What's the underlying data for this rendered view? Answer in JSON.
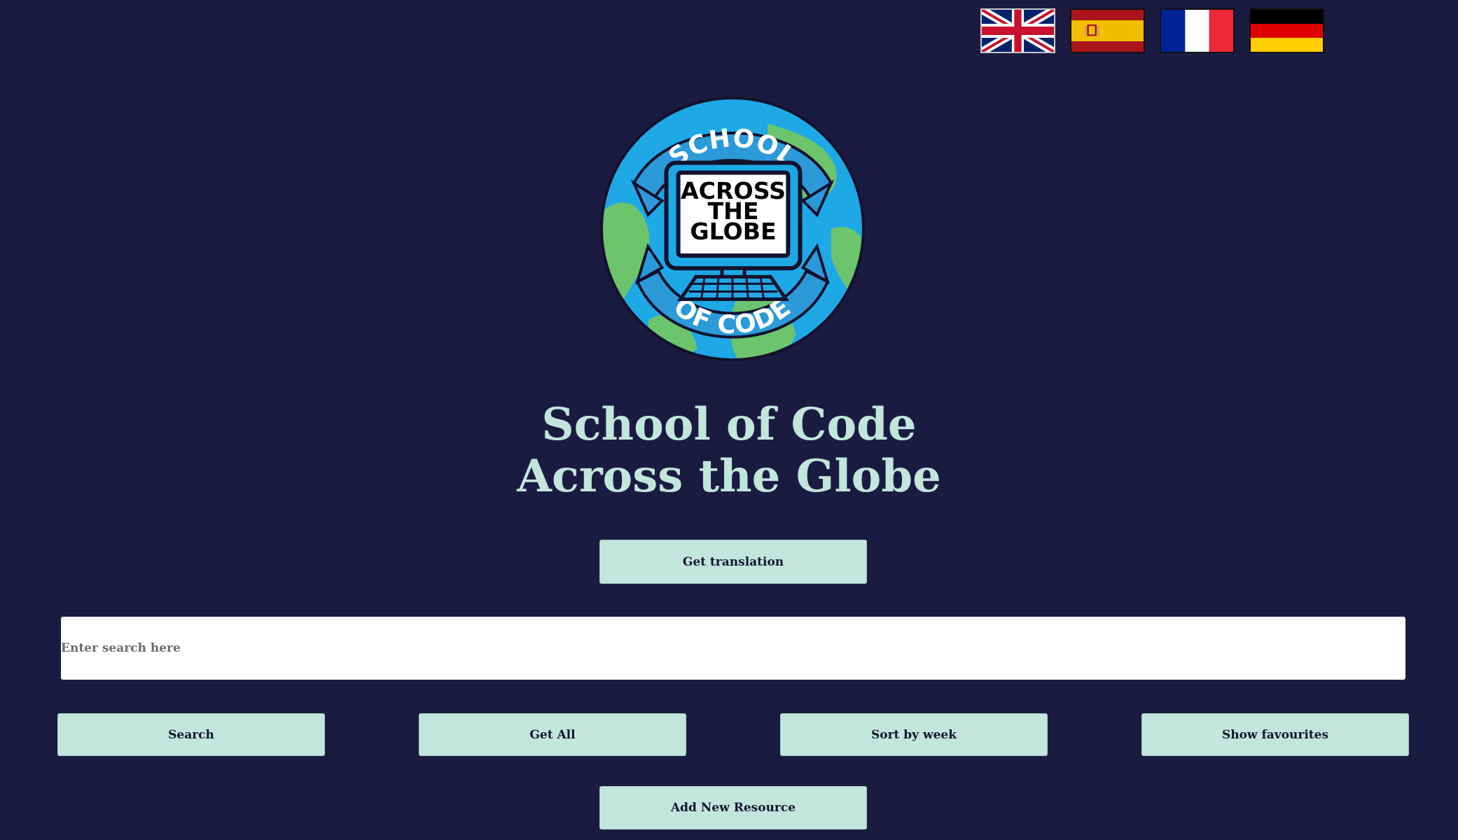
{
  "flags": [
    {
      "name": "uk-flag",
      "country": "United Kingdom"
    },
    {
      "name": "spain-flag",
      "country": "Spain"
    },
    {
      "name": "france-flag",
      "country": "France"
    },
    {
      "name": "germany-flag",
      "country": "Germany"
    }
  ],
  "logo": {
    "top_text": "SCHOOL",
    "screen_line1": "ACROSS",
    "screen_line2": "THE",
    "screen_line3": "GLOBE",
    "bottom_text": "OF CODE"
  },
  "title": {
    "line1": "School of Code",
    "line2": "Across the Globe"
  },
  "buttons": {
    "translate": "Get translation",
    "search": "Search",
    "get_all": "Get All",
    "sort_by_week": "Sort by week",
    "show_favourites": "Show favourites",
    "add_resource": "Add New Resource"
  },
  "search": {
    "placeholder": "Enter search here",
    "value": ""
  },
  "colors": {
    "background": "#1b1b42",
    "accent": "#c2e6dc",
    "ocean": "#1ea9e6",
    "land": "#6cc46c"
  }
}
